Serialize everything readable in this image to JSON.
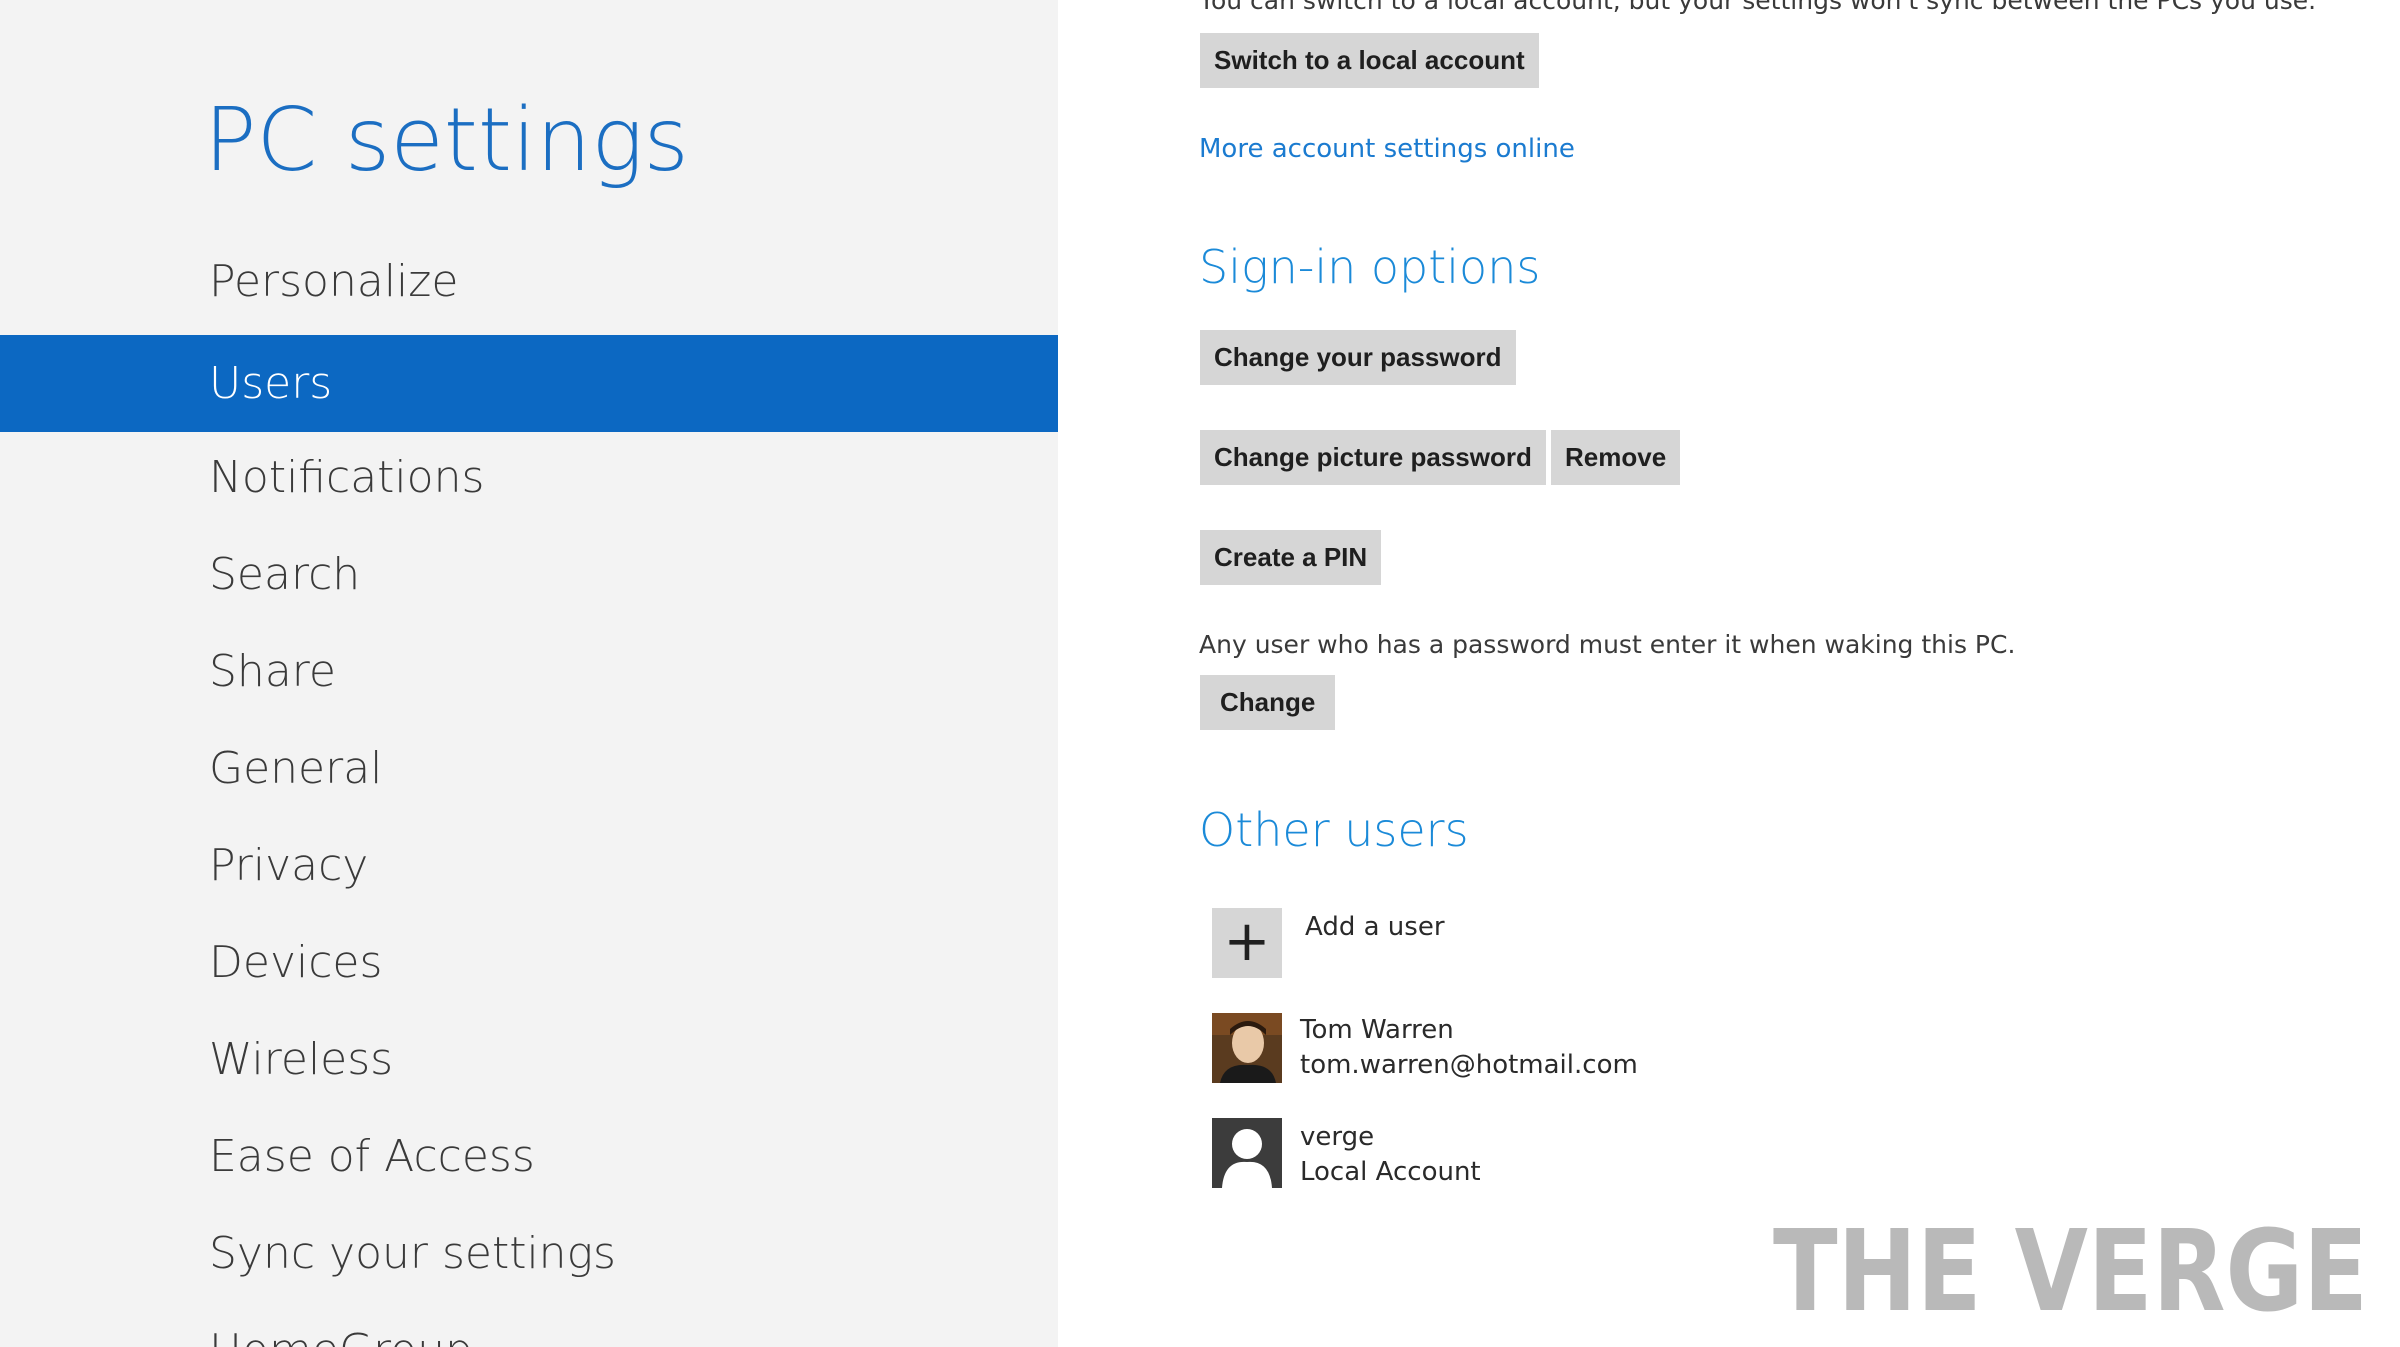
{
  "app": {
    "title": "PC settings"
  },
  "nav": {
    "items": [
      {
        "label": "Personalize"
      },
      {
        "label": "Users",
        "selected": true
      },
      {
        "label": "Notifications"
      },
      {
        "label": "Search"
      },
      {
        "label": "Share"
      },
      {
        "label": "General"
      },
      {
        "label": "Privacy"
      },
      {
        "label": "Devices"
      },
      {
        "label": "Wireless"
      },
      {
        "label": "Ease of Access"
      },
      {
        "label": "Sync your settings"
      },
      {
        "label": "HomeGroup"
      }
    ]
  },
  "account": {
    "switch_description": "You can switch to a local account, but your settings won't sync between the PCs you use.",
    "switch_button": "Switch to a local account",
    "more_settings_link": "More account settings online"
  },
  "signin": {
    "heading": "Sign-in options",
    "change_password_button": "Change your password",
    "change_picture_password_button": "Change picture password",
    "remove_button": "Remove",
    "create_pin_button": "Create a PIN",
    "wake_description": "Any user who has a password must enter it when waking this PC.",
    "change_button": "Change"
  },
  "other_users": {
    "heading": "Other users",
    "add_user_label": "Add a user",
    "users": [
      {
        "name": "Tom Warren",
        "detail": "tom.warren@hotmail.com",
        "avatar": "user-photo"
      },
      {
        "name": "verge",
        "detail": "Local Account",
        "avatar": "default-user-icon"
      }
    ]
  },
  "watermark": {
    "text": "THE VERGE"
  },
  "colors": {
    "accent": "#0c68c2",
    "title_blue": "#1b6ec2",
    "heading_blue": "#1b8ad8",
    "nav_background": "#f3f3f3",
    "button_background": "#d6d6d6"
  }
}
